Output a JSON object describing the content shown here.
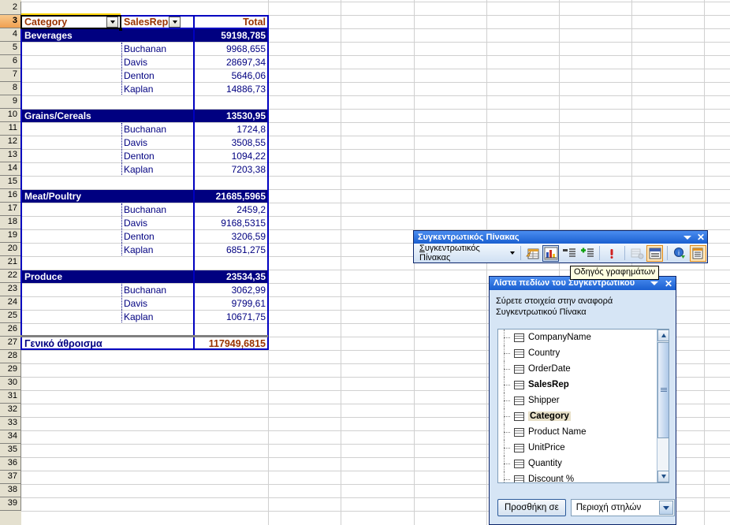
{
  "sheet": {
    "row_numbers": [
      2,
      3,
      4,
      5,
      6,
      7,
      8,
      9,
      10,
      11,
      12,
      13,
      14,
      15,
      16,
      17,
      18,
      19,
      20,
      21,
      22,
      23,
      24,
      25,
      26,
      27,
      28,
      29,
      30,
      31,
      32,
      33,
      34,
      35,
      36,
      37,
      38,
      39
    ],
    "selected_row": 3
  },
  "pivot": {
    "headers": {
      "category": "Category",
      "salesrep": "SalesRep",
      "total": "Total"
    },
    "groups": [
      {
        "name": "Beverages",
        "total": "59198,785",
        "rows": [
          {
            "rep": "Buchanan",
            "value": "9968,655"
          },
          {
            "rep": "Davis",
            "value": "28697,34"
          },
          {
            "rep": "Denton",
            "value": "5646,06"
          },
          {
            "rep": "Kaplan",
            "value": "14886,73"
          }
        ]
      },
      {
        "name": "Grains/Cereals",
        "total": "13530,95",
        "rows": [
          {
            "rep": "Buchanan",
            "value": "1724,8"
          },
          {
            "rep": "Davis",
            "value": "3508,55"
          },
          {
            "rep": "Denton",
            "value": "1094,22"
          },
          {
            "rep": "Kaplan",
            "value": "7203,38"
          }
        ]
      },
      {
        "name": "Meat/Poultry",
        "total": "21685,5965",
        "rows": [
          {
            "rep": "Buchanan",
            "value": "2459,2"
          },
          {
            "rep": "Davis",
            "value": "9168,5315"
          },
          {
            "rep": "Denton",
            "value": "3206,59"
          },
          {
            "rep": "Kaplan",
            "value": "6851,275"
          }
        ]
      },
      {
        "name": "Produce",
        "total": "23534,35",
        "rows": [
          {
            "rep": "Buchanan",
            "value": "3062,99"
          },
          {
            "rep": "Davis",
            "value": "9799,61"
          },
          {
            "rep": "Kaplan",
            "value": "10671,75"
          }
        ]
      }
    ],
    "grand_total": {
      "label": "Γενικό άθροισμα",
      "value": "117949,6815"
    }
  },
  "toolbar": {
    "title": "Συγκεντρωτικός Πίνακας",
    "menu_label": "Συγκεντρωτικός Πίνακας",
    "menu_accelerator": "Σ",
    "buttons": [
      {
        "name": "format-report-icon",
        "state": "normal"
      },
      {
        "name": "chart-wizard-icon",
        "state": "framed-blue"
      },
      {
        "name": "hide-detail-icon",
        "state": "normal"
      },
      {
        "name": "show-detail-icon",
        "state": "normal"
      },
      {
        "name": "refresh-data-icon",
        "state": "normal"
      },
      {
        "name": "field-settings-icon",
        "state": "disabled"
      },
      {
        "name": "hide-field-items-icon",
        "state": "framed-orange"
      },
      {
        "name": "include-hidden-items-icon",
        "state": "normal"
      },
      {
        "name": "field-list-icon",
        "state": "framed-orange"
      }
    ]
  },
  "tooltip": {
    "text": "Οδηγός γραφημάτων"
  },
  "field_list": {
    "title": "Λίστα πεδίων του Συγκεντρωτικού",
    "instruction_line1": "Σύρετε στοιχεία στην αναφορά",
    "instruction_line2": "Συγκεντρωτικού Πίνακα",
    "fields": [
      {
        "label": "CompanyName",
        "bold": false,
        "selected": false
      },
      {
        "label": "Country",
        "bold": false,
        "selected": false
      },
      {
        "label": "OrderDate",
        "bold": false,
        "selected": false
      },
      {
        "label": "SalesRep",
        "bold": true,
        "selected": false
      },
      {
        "label": "Shipper",
        "bold": false,
        "selected": false
      },
      {
        "label": "Category",
        "bold": true,
        "selected": true
      },
      {
        "label": "Product Name",
        "bold": false,
        "selected": false
      },
      {
        "label": "UnitPrice",
        "bold": false,
        "selected": false
      },
      {
        "label": "Quantity",
        "bold": false,
        "selected": false
      },
      {
        "label": "Discount %",
        "bold": false,
        "selected": false
      }
    ],
    "add_button": "Προσθήκη σε",
    "area_dropdown": "Περιοχή στηλών"
  },
  "colors": {
    "group_bg": "#000080",
    "header_text": "#993300",
    "detail_text": "#000080",
    "row_header_bg": "#e4e0cf",
    "row_header_selected": "#f0a050",
    "pivot_border": "#0000c0"
  }
}
